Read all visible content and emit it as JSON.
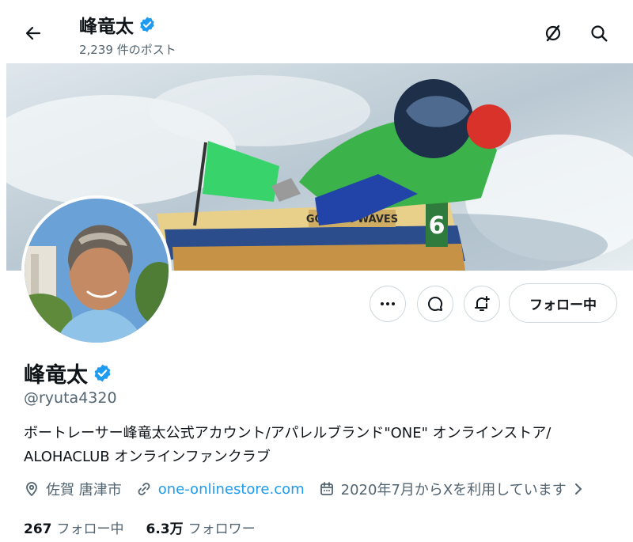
{
  "header": {
    "name": "峰竜太",
    "post_count": "2,239 件のポスト"
  },
  "banner": {
    "boat_text": "GOLDEN WAVES",
    "boat_number": "6"
  },
  "actions": {
    "follow_label": "フォロー中"
  },
  "profile": {
    "display_name": "峰竜太",
    "handle": "@ryuta4320",
    "bio_line1": "ボートレーサー峰竜太公式アカウント/アパレルブランド\"ONE\" オンラインストア/",
    "bio_line2": "ALOHACLUB オンラインファンクラブ",
    "location": "佐賀 唐津市",
    "website": "one-onlinestore.com",
    "joined": "2020年7月からXを利用しています"
  },
  "stats": {
    "following_count": "267",
    "following_label": "フォロー中",
    "followers_count": "6.3万",
    "followers_label": "フォロワー"
  },
  "colors": {
    "verified": "#1d9bf0",
    "link": "#1d9bf0",
    "muted": "#536471",
    "border": "#cfd9de"
  },
  "icons": [
    "back-arrow-icon",
    "grok-icon",
    "search-icon",
    "more-icon",
    "message-icon",
    "notification-bell-icon",
    "verified-badge-icon",
    "location-pin-icon",
    "link-icon",
    "calendar-icon",
    "chevron-right-icon"
  ]
}
